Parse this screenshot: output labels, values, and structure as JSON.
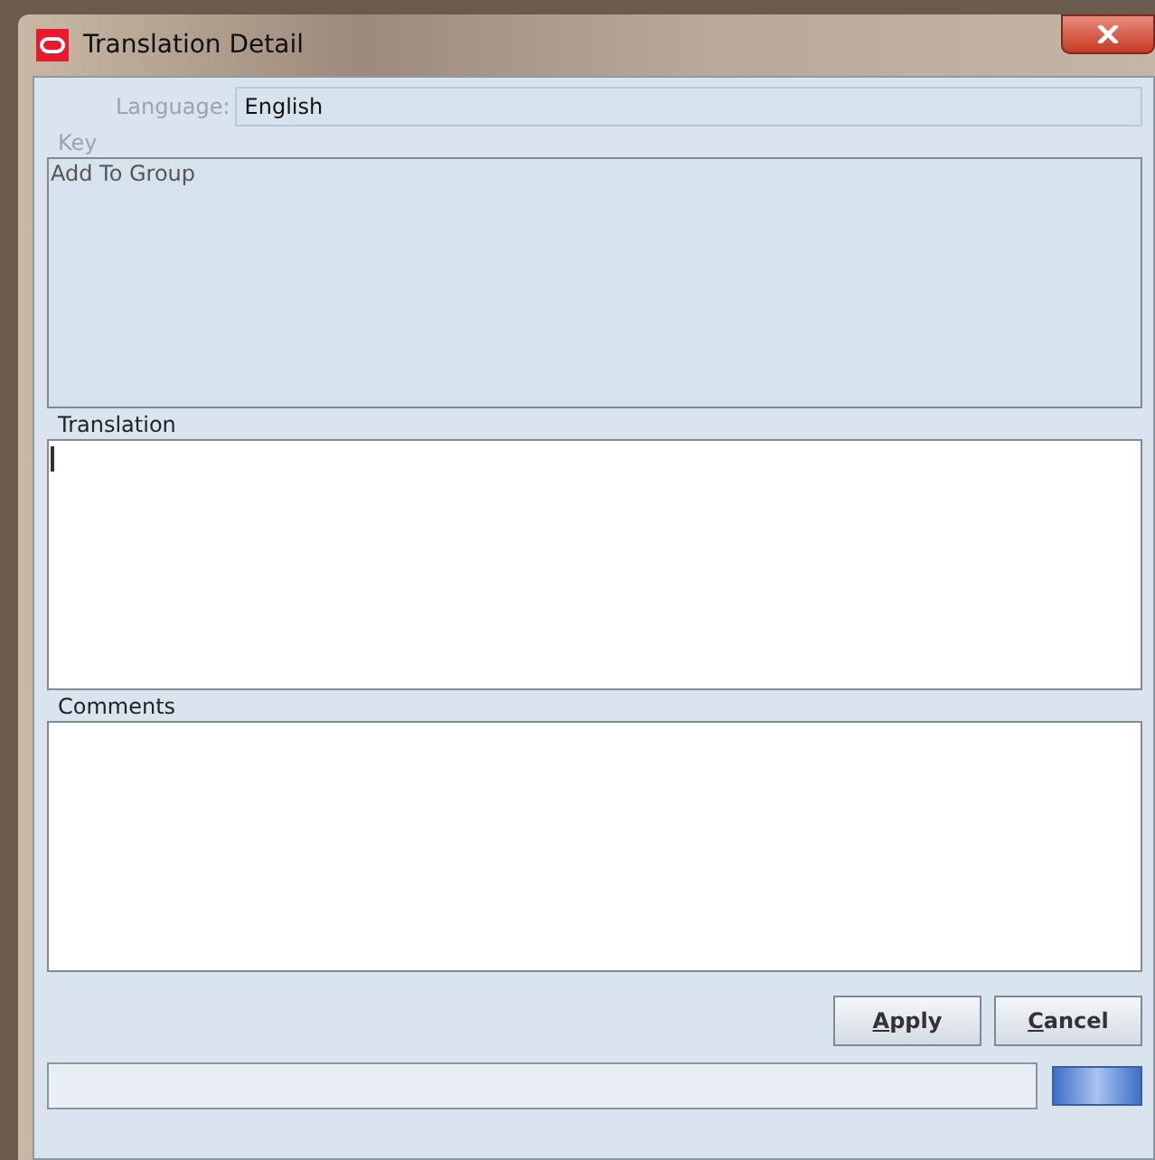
{
  "window": {
    "title": "Translation Detail"
  },
  "language": {
    "label": "Language:",
    "value": "English"
  },
  "key": {
    "label": "Key",
    "value": "Add To Group",
    "disabled": true
  },
  "translation": {
    "label": "Translation",
    "focused": true
  },
  "comments": {
    "label": "Comments"
  },
  "buttons": [
    {
      "label": "Apply"
    },
    {
      "label": "Cancel"
    }
  ]
}
